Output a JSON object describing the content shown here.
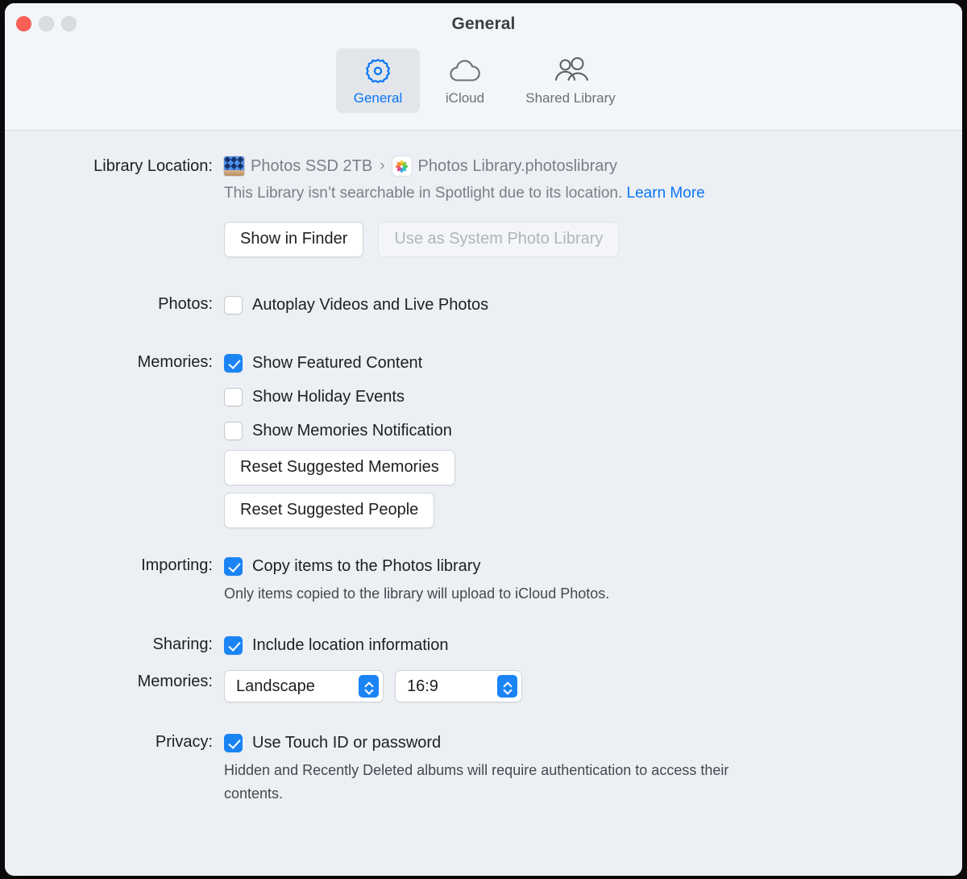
{
  "window": {
    "title": "General",
    "traffic_lights": [
      "close",
      "minimize",
      "zoom"
    ]
  },
  "toolbar": {
    "tabs": [
      {
        "label": "General",
        "icon": "gear-icon",
        "selected": true
      },
      {
        "label": "iCloud",
        "icon": "cloud-icon",
        "selected": false
      },
      {
        "label": "Shared Library",
        "icon": "people-icon",
        "selected": false
      }
    ]
  },
  "colors": {
    "accent_blue": "#1a84f5",
    "link_blue": "#0a76f6",
    "toolbar_bg": "#f2f6f9",
    "content_bg": "#eceff3",
    "label_text": "#1d1f22",
    "muted_text": "#7a7f86"
  },
  "library_location": {
    "label": "Library Location:",
    "volume": "Photos SSD 2TB",
    "separator": "›",
    "library_name": "Photos Library.photoslibrary",
    "volume_icon": "external-drive-icon",
    "library_icon": "photos-library-icon",
    "note": "This Library isn’t searchable in Spotlight due to its location.",
    "learn_more": "Learn More",
    "buttons": [
      {
        "label": "Show in Finder",
        "enabled": true
      },
      {
        "label": "Use as System Photo Library",
        "enabled": false
      }
    ]
  },
  "photos": {
    "label": "Photos:",
    "options": [
      {
        "label": "Autoplay Videos and Live Photos",
        "checked": false
      }
    ]
  },
  "memories": {
    "label": "Memories:",
    "options": [
      {
        "label": "Show Featured Content",
        "checked": true
      },
      {
        "label": "Show Holiday Events",
        "checked": false
      },
      {
        "label": "Show Memories Notification",
        "checked": false
      }
    ],
    "buttons": [
      {
        "label": "Reset Suggested Memories"
      },
      {
        "label": "Reset Suggested People"
      }
    ]
  },
  "importing": {
    "label": "Importing:",
    "options": [
      {
        "label": "Copy items to the Photos library",
        "checked": true
      }
    ],
    "note": "Only items copied to the library will upload to iCloud Photos."
  },
  "sharing": {
    "label": "Sharing:",
    "options": [
      {
        "label": "Include location information",
        "checked": true
      }
    ],
    "memories_label": "Memories:",
    "orientation_value": "Landscape",
    "aspect_value": "16:9"
  },
  "privacy": {
    "label": "Privacy:",
    "options": [
      {
        "label": "Use Touch ID or password",
        "checked": true
      }
    ],
    "note": "Hidden and Recently Deleted albums will require authentication to access their contents."
  }
}
